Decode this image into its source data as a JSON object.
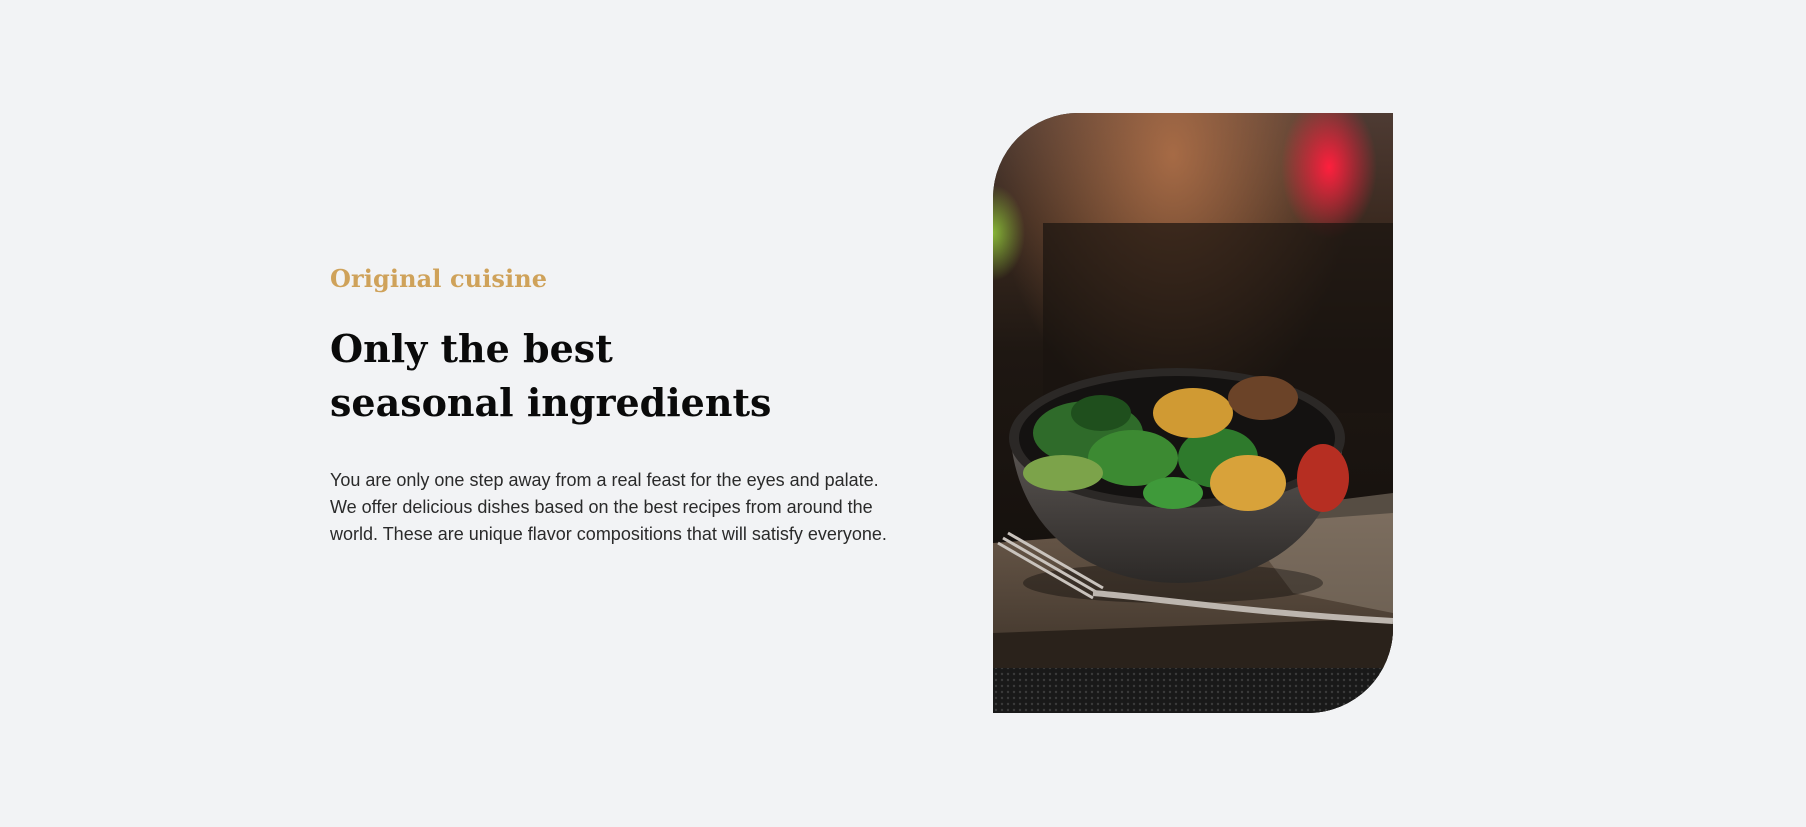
{
  "section": {
    "eyebrow": "Original cuisine",
    "heading": "Only the best seasonal ingredients",
    "body": "You are only one step away from a real feast for the eyes and palate. We offer delicious dishes based on the best recipes from around the world. These are unique flavor compositions that will satisfy everyone."
  },
  "colors": {
    "background": "#f2f3f5",
    "accent": "#cfa25a",
    "heading": "#0a0a0a",
    "body_text": "#2a2a2a"
  },
  "image": {
    "subject": "salad-bowl-photo"
  }
}
